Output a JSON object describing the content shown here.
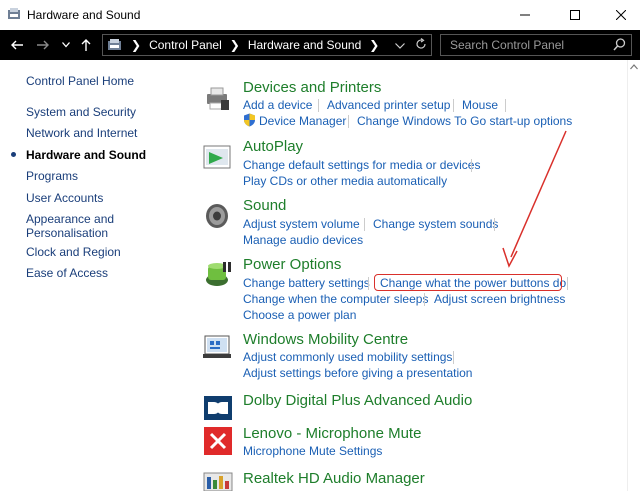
{
  "window": {
    "title": "Hardware and Sound",
    "controls": [
      "minimize",
      "maximize",
      "close"
    ]
  },
  "address_bar": {
    "breadcrumbs": [
      "Control Panel",
      "Hardware and Sound"
    ],
    "search_placeholder": "Search Control Panel"
  },
  "sidebar": {
    "items": [
      {
        "label": "Control Panel Home",
        "current": false
      },
      {
        "label": "System and Security",
        "current": false
      },
      {
        "label": "Network and Internet",
        "current": false
      },
      {
        "label": "Hardware and Sound",
        "current": true
      },
      {
        "label": "Programs",
        "current": false
      },
      {
        "label": "User Accounts",
        "current": false
      },
      {
        "label": "Appearance and",
        "current": false
      },
      {
        "label": "Personalisation",
        "current": false
      },
      {
        "label": "Clock and Region",
        "current": false
      },
      {
        "label": "Ease of Access",
        "current": false
      }
    ]
  },
  "categories": {
    "devices": {
      "title": "Devices and Printers",
      "links": [
        "Add a device",
        "Advanced printer setup",
        "Mouse",
        "Device Manager",
        "Change Windows To Go start-up options"
      ]
    },
    "autoplay": {
      "title": "AutoPlay",
      "links": [
        "Change default settings for media or devices",
        "Play CDs or other media automatically"
      ]
    },
    "sound": {
      "title": "Sound",
      "links": [
        "Adjust system volume",
        "Change system sounds",
        "Manage audio devices"
      ]
    },
    "power": {
      "title": "Power Options",
      "links": [
        "Change battery settings",
        "Change what the power buttons do",
        "Change when the computer sleeps",
        "Adjust screen brightness",
        "Choose a power plan"
      ]
    },
    "mobility": {
      "title": "Windows Mobility Centre",
      "links": [
        "Adjust commonly used mobility settings",
        "Adjust settings before giving a presentation"
      ]
    },
    "dolby": {
      "title": "Dolby Digital Plus Advanced Audio",
      "links": []
    },
    "lenovo": {
      "title": "Lenovo - Microphone Mute",
      "links": [
        "Microphone Mute Settings"
      ]
    },
    "realtek": {
      "title": "Realtek HD Audio Manager",
      "links": []
    }
  },
  "colors": {
    "category_title": "#1e7e2b",
    "link": "#1a5fb4",
    "annotation": "#d9302b"
  }
}
